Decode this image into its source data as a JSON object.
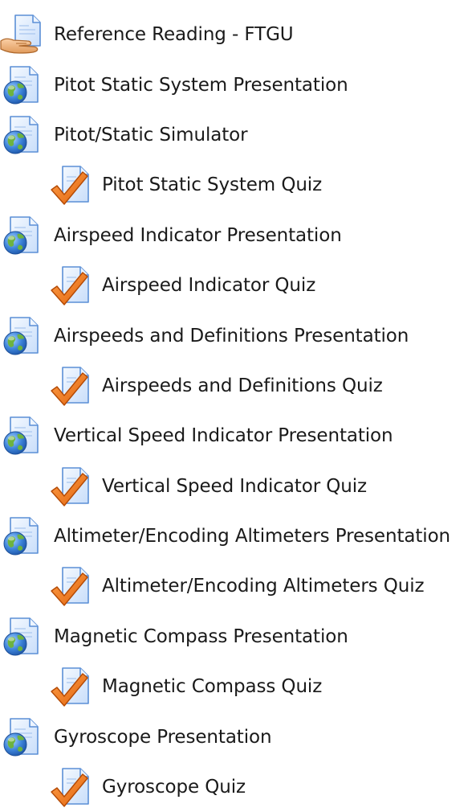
{
  "activities": [
    {
      "label": "Reference Reading - FTGU",
      "icon": "resource-hand-icon",
      "indent": false
    },
    {
      "label": "Pitot Static System Presentation",
      "icon": "url-globe-icon",
      "indent": false
    },
    {
      "label": "Pitot/Static Simulator",
      "icon": "url-globe-icon",
      "indent": false
    },
    {
      "label": "Pitot Static System Quiz",
      "icon": "quiz-check-icon",
      "indent": true
    },
    {
      "label": "Airspeed Indicator Presentation",
      "icon": "url-globe-icon",
      "indent": false
    },
    {
      "label": "Airspeed Indicator Quiz",
      "icon": "quiz-check-icon",
      "indent": true
    },
    {
      "label": "Airspeeds and Definitions Presentation",
      "icon": "url-globe-icon",
      "indent": false
    },
    {
      "label": "Airspeeds and Definitions Quiz",
      "icon": "quiz-check-icon",
      "indent": true
    },
    {
      "label": "Vertical Speed Indicator Presentation",
      "icon": "url-globe-icon",
      "indent": false
    },
    {
      "label": "Vertical Speed Indicator Quiz",
      "icon": "quiz-check-icon",
      "indent": true
    },
    {
      "label": "Altimeter/Encoding Altimeters Presentation",
      "icon": "url-globe-icon",
      "indent": false
    },
    {
      "label": "Altimeter/Encoding Altimeters Quiz",
      "icon": "quiz-check-icon",
      "indent": true
    },
    {
      "label": "Magnetic Compass Presentation",
      "icon": "url-globe-icon",
      "indent": false
    },
    {
      "label": "Magnetic Compass Quiz",
      "icon": "quiz-check-icon",
      "indent": true
    },
    {
      "label": "Gyroscope Presentation",
      "icon": "url-globe-icon",
      "indent": false
    },
    {
      "label": "Gyroscope Quiz",
      "icon": "quiz-check-icon",
      "indent": true
    }
  ],
  "colors": {
    "text": "#1a1a1a",
    "page_blue_light": "#dbe9fb",
    "page_blue_edge": "#5b8fd6",
    "globe_blue": "#3a7bd5",
    "globe_green": "#6db33f",
    "check_orange": "#f07a1e",
    "hand_tan": "#f2b27a"
  }
}
